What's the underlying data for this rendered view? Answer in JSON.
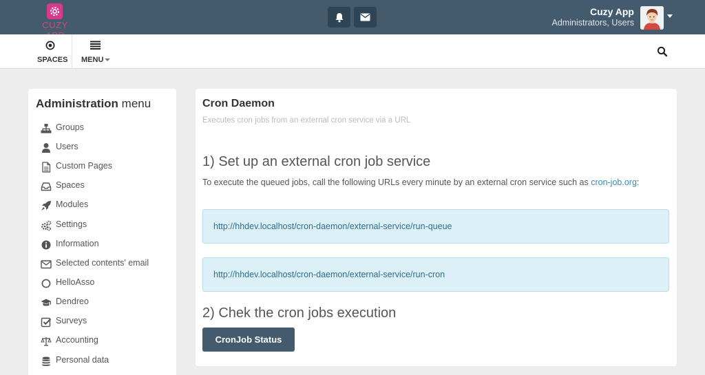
{
  "header": {
    "logo_text": "CUZY APP",
    "user_name": "Cuzy App",
    "user_groups": "Administrators, Users"
  },
  "subnav": {
    "spaces_label": "SPACES",
    "menu_label": "MENU"
  },
  "sidebar": {
    "title_bold": "Administration",
    "title_rest": " menu",
    "items": [
      {
        "label": "Groups",
        "icon": "sitemap-icon"
      },
      {
        "label": "Users",
        "icon": "user-icon"
      },
      {
        "label": "Custom Pages",
        "icon": "file-icon"
      },
      {
        "label": "Spaces",
        "icon": "inbox-icon"
      },
      {
        "label": "Modules",
        "icon": "rocket-icon"
      },
      {
        "label": "Settings",
        "icon": "cogs-icon"
      },
      {
        "label": "Information",
        "icon": "info-circle-icon"
      },
      {
        "label": "Selected contents' email",
        "icon": "envelope-icon"
      },
      {
        "label": "HelloAsso",
        "icon": "circle-icon"
      },
      {
        "label": "Dendreo",
        "icon": "graduation-cap-icon"
      },
      {
        "label": "Surveys",
        "icon": "check-square-icon"
      },
      {
        "label": "Accounting",
        "icon": "balance-scale-icon"
      },
      {
        "label": "Personal data",
        "icon": "database-icon"
      }
    ]
  },
  "main": {
    "title": "Cron Daemon",
    "subtitle": "Executes cron jobs from an external cron service via a URL",
    "step1_heading": "1) Set up an external cron job service",
    "instruction_text": "To execute the queued jobs, call the following URLs every minute by an external cron service such as ",
    "instruction_link": "cron-job.org",
    "instruction_end": ":",
    "urls": [
      "http://hhdev.localhost/cron-daemon/external-service/run-queue",
      "http://hhdev.localhost/cron-daemon/external-service/run-cron"
    ],
    "step2_heading": "2) Chek the cron jobs execution",
    "status_button": "CronJob Status"
  },
  "colors": {
    "topbar": "#445b6e",
    "accent": "#d63a8f",
    "link": "#2a8fbd",
    "info_box": "#dcf0f8"
  }
}
